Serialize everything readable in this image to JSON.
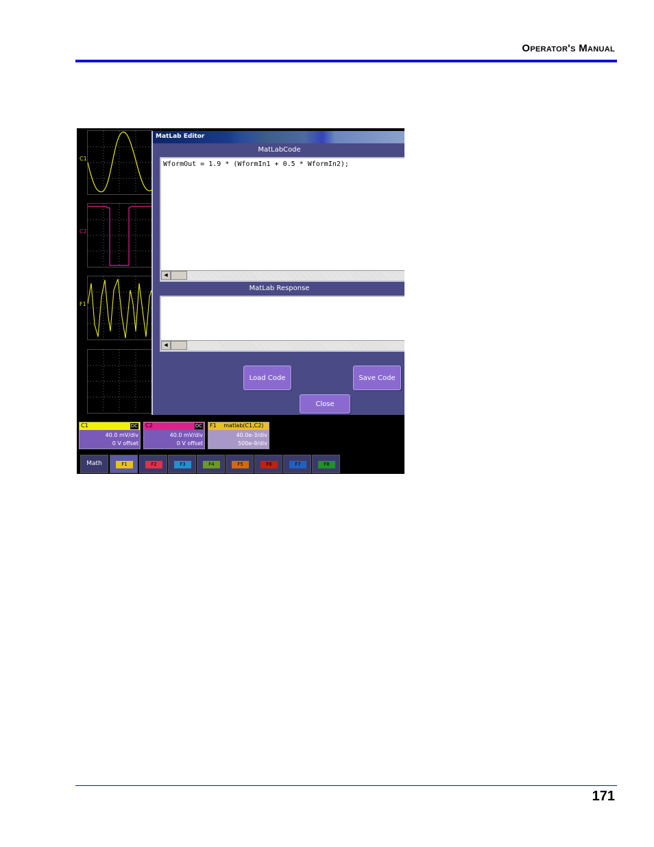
{
  "header": {
    "title": "Operator's Manual"
  },
  "footer": {
    "page_number": "171"
  },
  "screenshot": {
    "channels": [
      {
        "label": "C1",
        "color": "#e8e820"
      },
      {
        "label": "C2",
        "color": "#e0208a"
      },
      {
        "label": "F1",
        "color": "#e8e820"
      }
    ],
    "editor": {
      "title": "MatLab Editor",
      "code_label": "MatLabCode",
      "code_text": "WformOut = 1.9 * (WformIn1 + 0.5 * WformIn2);",
      "response_label": "MatLab Response",
      "response_text": "",
      "load_button": "Load Code",
      "save_button": "Save Code",
      "close_button": "Close"
    },
    "descriptors": [
      {
        "name": "C1",
        "coupling": "DC",
        "line1": "40.0 mV/div",
        "line2": "0 V offset",
        "color": "#f2f200"
      },
      {
        "name": "C2",
        "coupling": "DC",
        "line1": "40.0 mV/div",
        "line2": "0 V offset",
        "color": "#e0208a"
      },
      {
        "name": "F1",
        "function": "matlab(C1,C2)",
        "line1": "40.0e-3/div",
        "line2": "500e-9/div",
        "color": "#e8c020"
      }
    ],
    "tabs": [
      {
        "label": "Math"
      },
      {
        "label": "F1",
        "color": "#e8c020"
      },
      {
        "label": "F2",
        "color": "#e0304a"
      },
      {
        "label": "F3",
        "color": "#2090d0"
      },
      {
        "label": "F4",
        "color": "#6a9a20"
      },
      {
        "label": "F5",
        "color": "#d06a10"
      },
      {
        "label": "F6",
        "color": "#c02010"
      },
      {
        "label": "F7",
        "color": "#2060c0"
      },
      {
        "label": "F8",
        "color": "#20902a"
      }
    ]
  }
}
